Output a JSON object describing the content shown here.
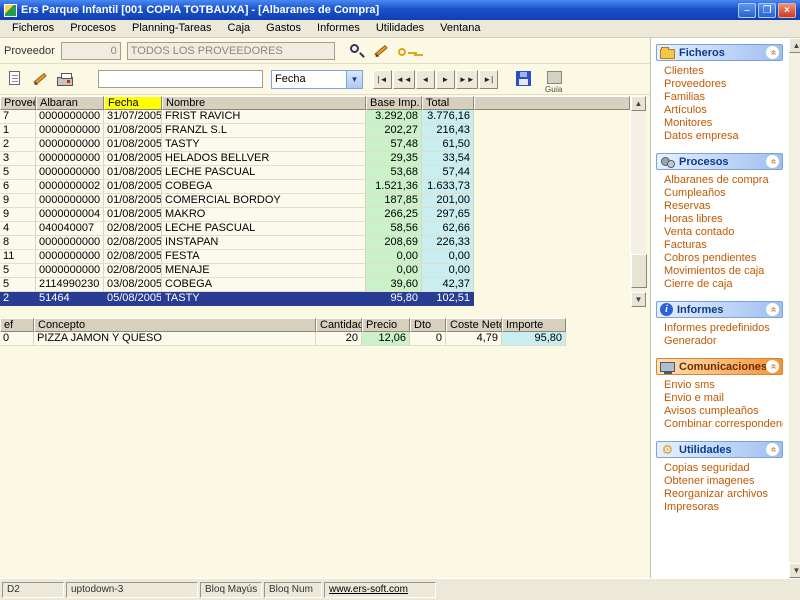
{
  "colors": {
    "fecha_header": "#FFFF00",
    "base_imp_column": "#C9F2C9",
    "total_column": "#C9EEF2",
    "selected_row": "#283C94",
    "sidebar_link": "#C05A00"
  },
  "window": {
    "title": "Ers Parque Infantil [001 COPIA TOTBAUXA] - [Albaranes de Compra]",
    "controls": {
      "minimize": "–",
      "maximize": "❐",
      "close": "×"
    }
  },
  "menu": {
    "items": [
      "Ficheros",
      "Procesos",
      "Planning-Tareas",
      "Caja",
      "Gastos",
      "Informes",
      "Utilidades",
      "Ventana"
    ]
  },
  "filters": {
    "proveedor_label": "Proveedor",
    "proveedor_code": "0",
    "proveedor_name": "TODOS LOS PROVEEDORES",
    "search_value": "",
    "order_field": "Fecha",
    "combo_arrow": "▼",
    "guide_caption": "Guía"
  },
  "nav": {
    "buttons": [
      {
        "name": "first",
        "glyph": "|◄"
      },
      {
        "name": "prev-page",
        "glyph": "◄◄"
      },
      {
        "name": "prev",
        "glyph": "◄"
      },
      {
        "name": "next",
        "glyph": "►"
      },
      {
        "name": "next-page",
        "glyph": "►►"
      },
      {
        "name": "last",
        "glyph": "►|"
      }
    ]
  },
  "main_table": {
    "headers": [
      "Proveedor",
      "Albaran",
      "Fecha",
      "Nombre",
      "Base Imp.",
      "Total"
    ],
    "selected_index": 13,
    "rows": [
      [
        "7",
        "0000000000",
        "31/07/2005",
        "FRIST RAVICH",
        "3.292,08",
        "3.776,16"
      ],
      [
        "1",
        "0000000000",
        "01/08/2005",
        "FRANZL S.L",
        "202,27",
        "216,43"
      ],
      [
        "2",
        "0000000000",
        "01/08/2005",
        "TASTY",
        "57,48",
        "61,50"
      ],
      [
        "3",
        "0000000000",
        "01/08/2005",
        "HELADOS BELLVER",
        "29,35",
        "33,54"
      ],
      [
        "5",
        "0000000000",
        "01/08/2005",
        "LECHE PASCUAL",
        "53,68",
        "57,44"
      ],
      [
        "6",
        "0000000002",
        "01/08/2005",
        "COBEGA",
        "1.521,36",
        "1.633,73"
      ],
      [
        "9",
        "0000000000",
        "01/08/2005",
        "COMERCIAL BORDOY",
        "187,85",
        "201,00"
      ],
      [
        "9",
        "0000000004",
        "01/08/2005",
        "MAKRO",
        "266,25",
        "297,65"
      ],
      [
        "4",
        "040040007",
        "02/08/2005",
        "LECHE PASCUAL",
        "58,56",
        "62,66"
      ],
      [
        "8",
        "0000000000",
        "02/08/2005",
        "INSTAPAN",
        "208,69",
        "226,33"
      ],
      [
        "11",
        "0000000000",
        "02/08/2005",
        "FESTA",
        "0,00",
        "0,00"
      ],
      [
        "5",
        "0000000000",
        "02/08/2005",
        "MENAJE",
        "0,00",
        "0,00"
      ],
      [
        "5",
        "2114990230",
        "03/08/2005",
        "COBEGA",
        "39,60",
        "42,37"
      ],
      [
        "2",
        "51464",
        "05/08/2005",
        "TASTY",
        "95,80",
        "102,51"
      ]
    ]
  },
  "detail_table": {
    "headers": [
      "ef",
      "Concepto",
      "Cantidad",
      "Precio",
      "Dto",
      "Coste Neto",
      "Importe"
    ],
    "rows": [
      [
        "0",
        "PIZZA JAMON Y QUESO",
        "20",
        "12,06",
        "0",
        "4,79",
        "95,80"
      ]
    ]
  },
  "sidebar": {
    "sections": [
      {
        "title": "Ficheros",
        "icon": "folder-icon",
        "style": "blue",
        "items": [
          "Clientes",
          "Proveedores",
          "Familias",
          "Artículos",
          "Monitores",
          "Datos empresa"
        ]
      },
      {
        "title": "Procesos",
        "icon": "gears-icon",
        "style": "blue",
        "items": [
          "Albaranes de compra",
          "Cumpleaños",
          "Reservas",
          "Horas libres",
          "Venta contado",
          "Facturas",
          "Cobros pendientes",
          "Movimientos de caja",
          "Cierre de caja"
        ]
      },
      {
        "title": "Informes",
        "icon": "info-icon",
        "style": "blue",
        "items": [
          "Informes predefinidos",
          "Generador"
        ]
      },
      {
        "title": "Comunicaciones",
        "icon": "computer-icon",
        "style": "orange",
        "items": [
          "Envio sms",
          "Envio e mail",
          "Avisos cumpleaños",
          "Combinar correspondencia"
        ]
      },
      {
        "title": "Utilidades",
        "icon": "gear-icon",
        "style": "blue",
        "items": [
          "Copias seguridad",
          "Obtener imagenes",
          "Reorganizar archivos",
          "Impresoras"
        ]
      }
    ],
    "collapse_chevron": "«",
    "info_glyph": "i",
    "gear_glyph": "⚙"
  },
  "statusbar": {
    "panels": [
      "D2",
      "uptodown-3",
      "Bloq Mayús",
      "Bloq Num",
      "www.ers-soft.com"
    ]
  },
  "scrollbar": {
    "up": "▲",
    "down": "▼"
  }
}
